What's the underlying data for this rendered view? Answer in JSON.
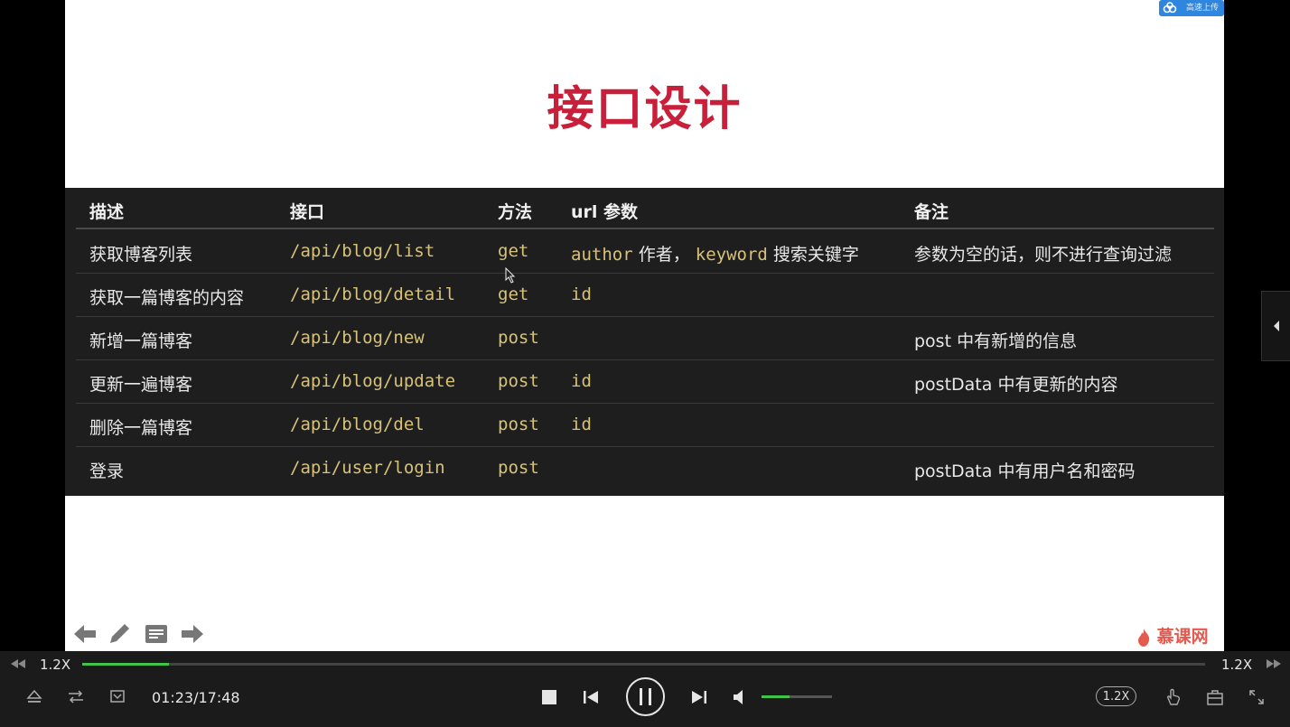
{
  "slide": {
    "badge_label": "高速上传",
    "title": "接口设计"
  },
  "table": {
    "headers": [
      "描述",
      "接口",
      "方法",
      "url 参数",
      "备注"
    ],
    "rows": [
      {
        "desc": "获取博客列表",
        "api": "/api/blog/list",
        "method": "get",
        "param_a_code": "author",
        "param_a_text": "作者，",
        "param_b_code": "keyword",
        "param_b_text": "搜索关键字",
        "param": "",
        "note": "参数为空的话，则不进行查询过滤"
      },
      {
        "desc": "获取一篇博客的内容",
        "api": "/api/blog/detail",
        "method": "get",
        "param": "id",
        "note": ""
      },
      {
        "desc": "新增一篇博客",
        "api": "/api/blog/new",
        "method": "post",
        "param": "",
        "note": "post 中有新增的信息"
      },
      {
        "desc": "更新一遍博客",
        "api": "/api/blog/update",
        "method": "post",
        "param": "id",
        "note": "postData 中有更新的内容"
      },
      {
        "desc": "删除一篇博客",
        "api": "/api/blog/del",
        "method": "post",
        "param": "id",
        "note": ""
      },
      {
        "desc": "登录",
        "api": "/api/user/login",
        "method": "post",
        "param": "",
        "note": "postData 中有用户名和密码"
      }
    ]
  },
  "logo_text": "慕课网",
  "player": {
    "rate_left": "1.2X",
    "rate_right": "1.2X",
    "rate_pill": "1.2X",
    "time": "01:23/17:48",
    "progress_fraction": 0.077,
    "volume_fraction": 0.4,
    "accent_color": "#3fc44a"
  },
  "colors": {
    "title": "#c8203a",
    "code": "#d7c27a",
    "table_bg": "#1e1e1e"
  }
}
